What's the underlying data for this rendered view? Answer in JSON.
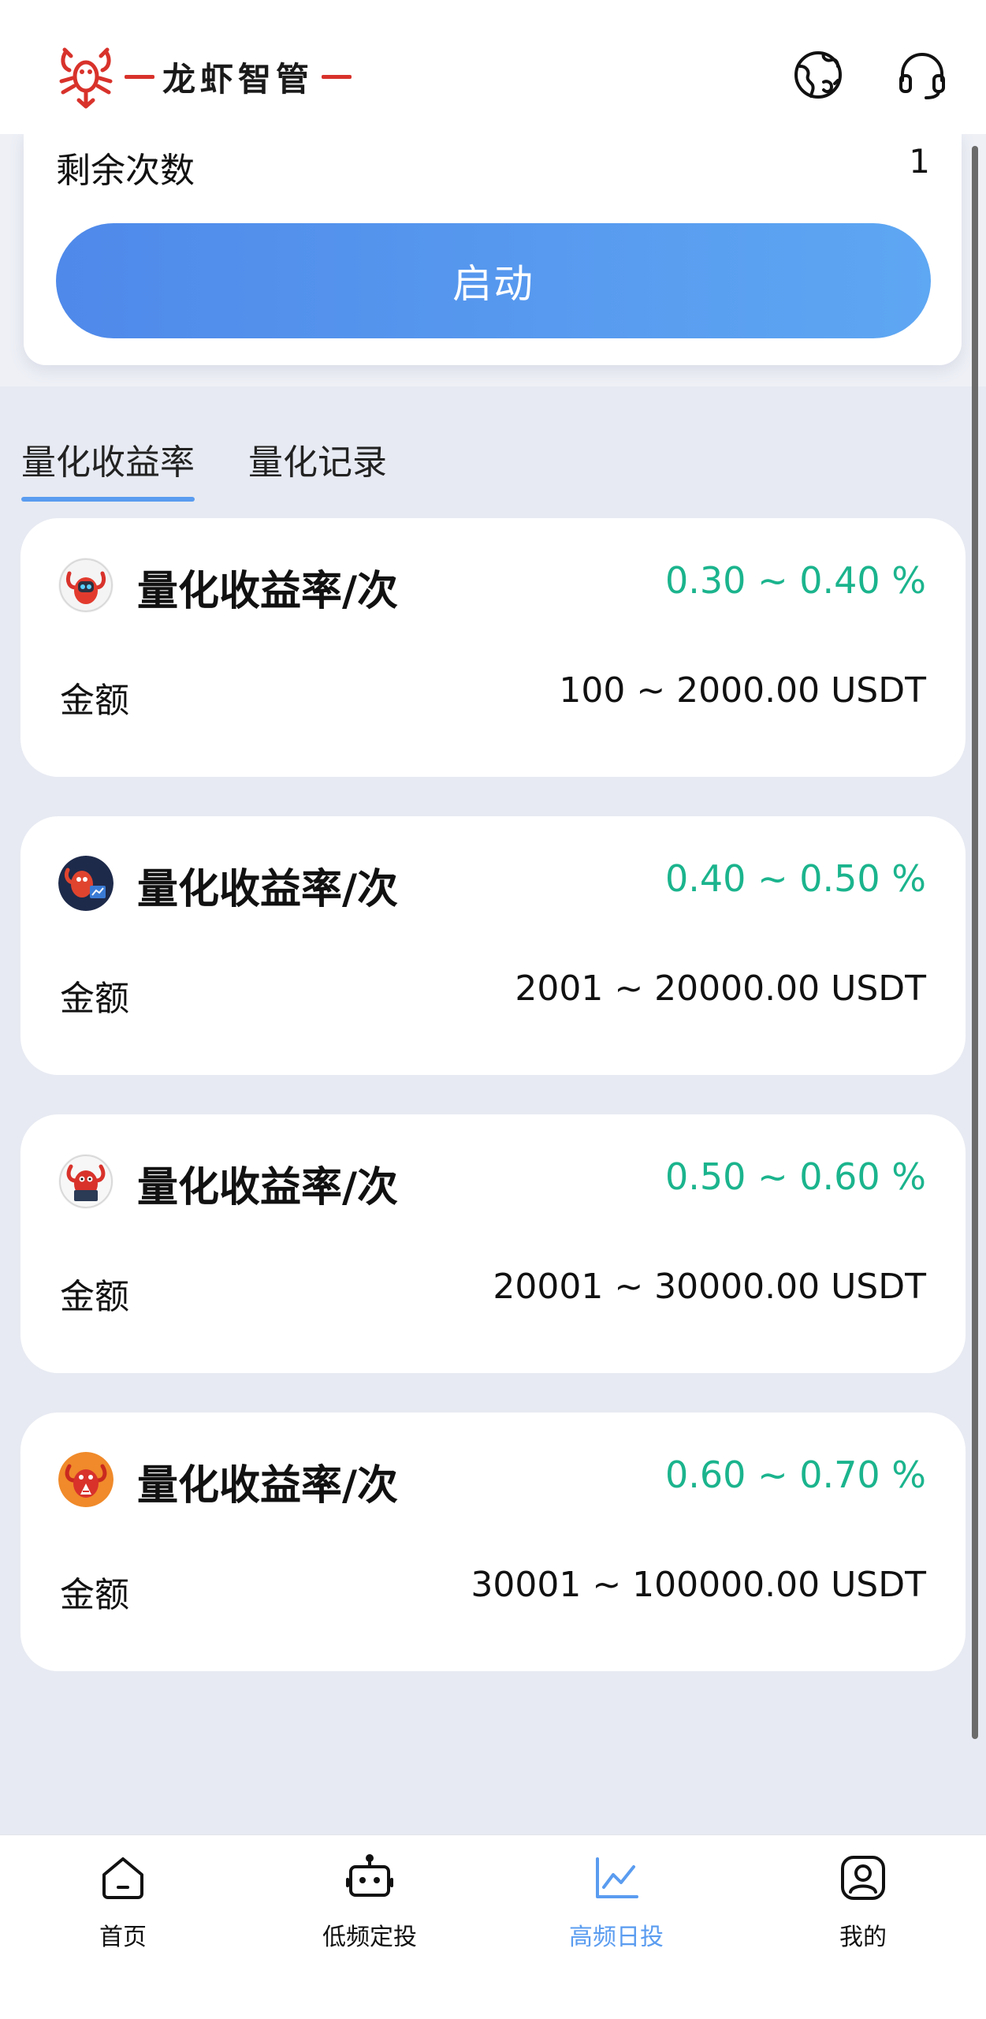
{
  "header": {
    "brand": "龙虾智管",
    "icons": [
      "lobster-logo-icon",
      "globe-icon",
      "headset-icon"
    ]
  },
  "start_panel": {
    "remaining_label": "剩余次数",
    "remaining_value": "1",
    "start_button": "启动"
  },
  "tabs": [
    {
      "label": "量化收益率",
      "active": true
    },
    {
      "label": "量化记录",
      "active": false
    }
  ],
  "cards": [
    {
      "title": "量化收益率/次",
      "rate": "0.30 ~ 0.40 %",
      "amount_label": "金额",
      "amount": "100 ~ 2000.00 USDT"
    },
    {
      "title": "量化收益率/次",
      "rate": "0.40 ~ 0.50 %",
      "amount_label": "金额",
      "amount": "2001 ~ 20000.00 USDT"
    },
    {
      "title": "量化收益率/次",
      "rate": "0.50 ~ 0.60 %",
      "amount_label": "金额",
      "amount": "20001 ~ 30000.00 USDT"
    },
    {
      "title": "量化收益率/次",
      "rate": "0.60 ~ 0.70 %",
      "amount_label": "金额",
      "amount": "30001 ~ 100000.00 USDT"
    }
  ],
  "bottom_nav": [
    {
      "label": "首页",
      "icon": "home-icon",
      "active": false
    },
    {
      "label": "低频定投",
      "icon": "robot-icon",
      "active": false
    },
    {
      "label": "高频日投",
      "icon": "chart-line-icon",
      "active": true
    },
    {
      "label": "我的",
      "icon": "user-icon",
      "active": false
    }
  ],
  "colors": {
    "accent": "#5a9cf0",
    "rate_green": "#1bb48d",
    "brand_red": "#d8322b"
  }
}
